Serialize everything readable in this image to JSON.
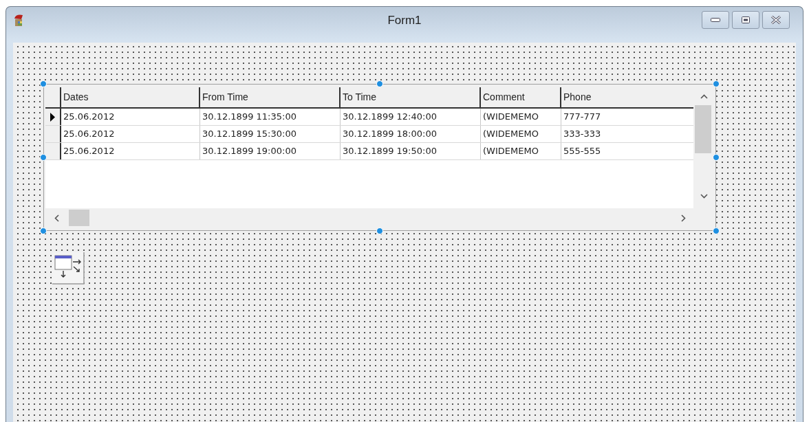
{
  "window": {
    "title": "Form1"
  },
  "grid": {
    "columns": [
      "Dates",
      "From Time",
      "To Time",
      "Comment",
      "Phone"
    ],
    "rows": [
      {
        "current": true,
        "cells": [
          "25.06.2012",
          "30.12.1899 11:35:00",
          "30.12.1899 12:40:00",
          "(WIDEMEMO",
          "777-777"
        ]
      },
      {
        "current": false,
        "cells": [
          "25.06.2012",
          "30.12.1899 15:30:00",
          "30.12.1899 18:00:00",
          "(WIDEMEMO",
          "333-333"
        ]
      },
      {
        "current": false,
        "cells": [
          "25.06.2012",
          "30.12.1899 19:00:00",
          "30.12.1899 19:50:00",
          "(WIDEMEMO",
          "555-555"
        ]
      }
    ],
    "selected": true
  }
}
